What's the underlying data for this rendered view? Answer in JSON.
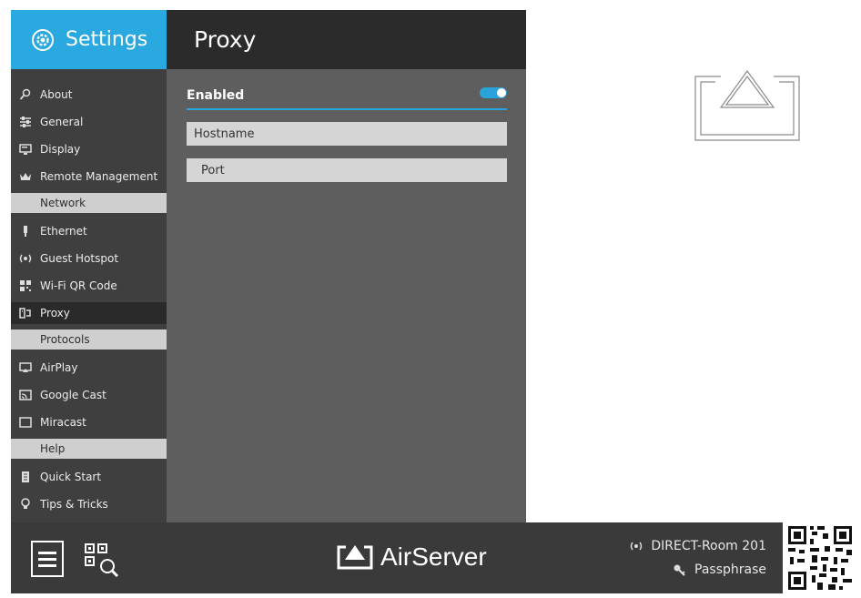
{
  "sidebar": {
    "title": "Settings",
    "items": [
      {
        "label": "About",
        "icon": "search-person-icon"
      },
      {
        "label": "General",
        "icon": "sliders-icon"
      },
      {
        "label": "Display",
        "icon": "display-icon"
      },
      {
        "label": "Remote Management",
        "icon": "crown-icon"
      },
      {
        "label": "Ethernet",
        "icon": "ethernet-plug-icon"
      },
      {
        "label": "Guest Hotspot",
        "icon": "hotspot-icon"
      },
      {
        "label": "Wi-Fi QR Code",
        "icon": "qr-code-icon"
      },
      {
        "label": "Proxy",
        "icon": "proxy-icon"
      },
      {
        "label": "AirPlay",
        "icon": "airplay-icon"
      },
      {
        "label": "Google Cast",
        "icon": "cast-icon"
      },
      {
        "label": "Miracast",
        "icon": "miracast-icon"
      },
      {
        "label": "Quick Start",
        "icon": "document-icon"
      },
      {
        "label": "Tips & Tricks",
        "icon": "lightbulb-icon"
      }
    ],
    "sections": [
      "Network",
      "Protocols",
      "Help"
    ],
    "active_item": "Proxy"
  },
  "content": {
    "title": "Proxy",
    "enabled_label": "Enabled",
    "enabled": true,
    "hostname_placeholder": "Hostname",
    "port_placeholder": "Port"
  },
  "footer": {
    "brand": "AirServer",
    "room_name": "DIRECT-Room 201",
    "passphrase": "Passphrase"
  },
  "colors": {
    "accent": "#29a9df",
    "sidebar_bg": "#3f3f3f",
    "content_bg": "#5e5e5e",
    "header_dark": "#2b2b2b",
    "section_bg": "#cfcfcf"
  }
}
